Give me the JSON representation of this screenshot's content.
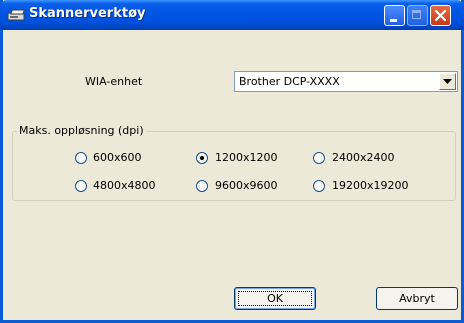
{
  "window": {
    "title": "Skannerverktøy"
  },
  "device": {
    "label": "WIA-enhet",
    "selected": "Brother DCP-XXXX"
  },
  "resolution": {
    "group_label": "Maks. oppløsning (dpi)",
    "options": [
      {
        "label": "600x600",
        "checked": false
      },
      {
        "label": "1200x1200",
        "checked": true
      },
      {
        "label": "2400x2400",
        "checked": false
      },
      {
        "label": "4800x4800",
        "checked": false
      },
      {
        "label": "9600x9600",
        "checked": false
      },
      {
        "label": "19200x19200",
        "checked": false
      }
    ]
  },
  "buttons": {
    "ok": "OK",
    "cancel": "Avbryt"
  },
  "colors": {
    "titlebar": "#0054e3",
    "dialog_bg": "#ece9d8",
    "close_button": "#c33a16"
  }
}
